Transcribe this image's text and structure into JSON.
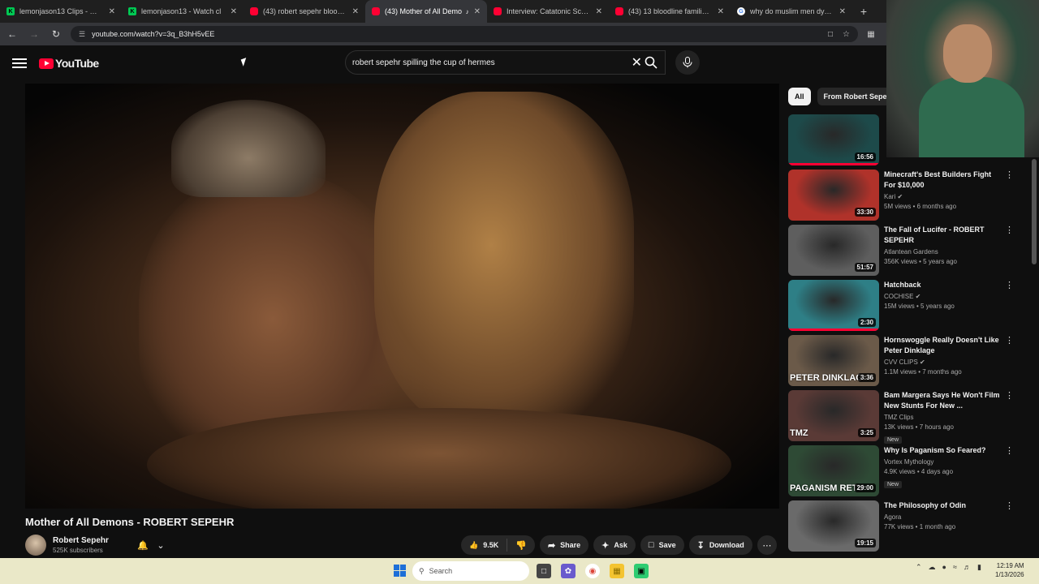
{
  "tabs": [
    {
      "title": "lemonjason13 Clips - Watch",
      "fav": "K",
      "type": "k"
    },
    {
      "title": "lemonjason13 - Watch cl",
      "fav": "K",
      "type": "k"
    },
    {
      "title": "(43) robert sepehr bloodline",
      "fav": "",
      "type": "yt"
    },
    {
      "title": "(43) Mother of All Demo",
      "fav": "",
      "type": "yt",
      "active": true
    },
    {
      "title": "Interview: Catatonic Schizoph",
      "fav": "",
      "type": "yt"
    },
    {
      "title": "(43) 13 bloodline families - Y",
      "fav": "",
      "type": "yt"
    },
    {
      "title": "why do muslim men dye the",
      "fav": "G",
      "type": "g"
    }
  ],
  "browser": {
    "url": "youtube.com/watch?v=3q_B3hH5vEE",
    "new_tab": "+"
  },
  "youtube": {
    "logo_text": "YouTube",
    "search_query": "robert sepehr spilling the cup of hermes"
  },
  "video": {
    "title": "Mother of All Demons - ROBERT SEPEHR",
    "channel": "Robert Sepehr",
    "subscribers": "525K subscribers",
    "likes": "9.5K",
    "share": "Share",
    "ask": "Ask",
    "save": "Save",
    "download": "Download"
  },
  "chips": [
    "All",
    "From Robert Sepehr"
  ],
  "recommendations": [
    {
      "title": "",
      "channel": "",
      "meta": "",
      "duration": "16:56",
      "thumb": "#1d4a4a",
      "progress": true
    },
    {
      "title": "Minecraft's Best Builders Fight For $10,000",
      "channel": "Kari",
      "meta": "5M views • 6 months ago",
      "duration": "33:30",
      "thumb": "#b0322a",
      "verified": true
    },
    {
      "title": "The Fall of Lucifer - ROBERT SEPEHR",
      "channel": "Atlantean Gardens",
      "meta": "356K views • 5 years ago",
      "duration": "51:57",
      "thumb": "#5e5e5e"
    },
    {
      "title": "Hatchback",
      "channel": "COCHISE",
      "meta": "15M views • 5 years ago",
      "duration": "2:30",
      "thumb": "#2e7f86",
      "verified": true,
      "progress": true
    },
    {
      "title": "Hornswoggle Really Doesn't Like Peter Dinklage",
      "channel": "CVV CLIPS",
      "meta": "1.1M views • 7 months ago",
      "duration": "3:36",
      "thumb": "#6b5a49",
      "verified": true,
      "thumb_text": "PETER DINKLAG"
    },
    {
      "title": "Bam Margera Says He Won't Film New Stunts For New ...",
      "channel": "TMZ Clips",
      "meta": "13K views • 7 hours ago",
      "duration": "3:25",
      "thumb": "#5a3a36",
      "badge": "New",
      "thumb_text": "TMZ"
    },
    {
      "title": "Why Is Paganism So Feared?",
      "channel": "Vortex Mythology",
      "meta": "4.9K views • 4 days ago",
      "duration": "29:00",
      "thumb": "#2e4a35",
      "badge": "New",
      "thumb_text": "PAGANISM RETU"
    },
    {
      "title": "The Philosophy of Odin",
      "channel": "Agora",
      "meta": "77K views • 1 month ago",
      "duration": "19:15",
      "thumb": "#6a6a6a"
    }
  ],
  "taskbar": {
    "search_placeholder": "Search",
    "time": "12:19 AM",
    "date": "1/13/2026"
  }
}
